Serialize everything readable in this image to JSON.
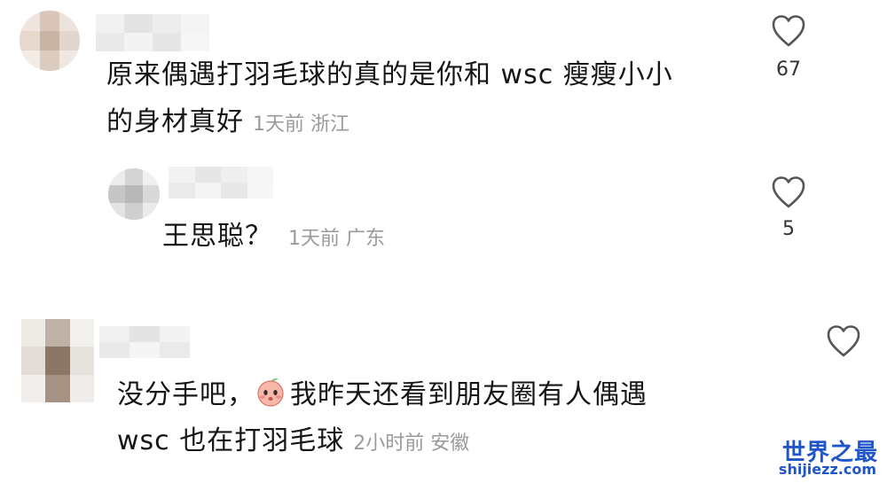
{
  "comments": [
    {
      "line1": "原来偶遇打羽毛球的真的是你和 wsc 瘦瘦小小",
      "line2": "的身材真好",
      "time": "1天前",
      "location": "浙江",
      "likes": "67"
    },
    {
      "text": "王思聪？",
      "time": "1天前",
      "location": "广东",
      "likes": "5"
    },
    {
      "line1_start": "没分手吧，",
      "line1_rest": "我昨天还看到朋友圈有人偶遇",
      "line2": "wsc 也在打羽毛球",
      "time": "2小时前",
      "location": "安徽",
      "emoji": "peach-face-emoji"
    }
  ],
  "watermark": {
    "title": "世界之最",
    "domain": "shijiezz.com"
  },
  "colors": {
    "text": "#161616",
    "meta": "#9a9a9a",
    "heart": "#555555",
    "watermark": "#1f55c9"
  }
}
